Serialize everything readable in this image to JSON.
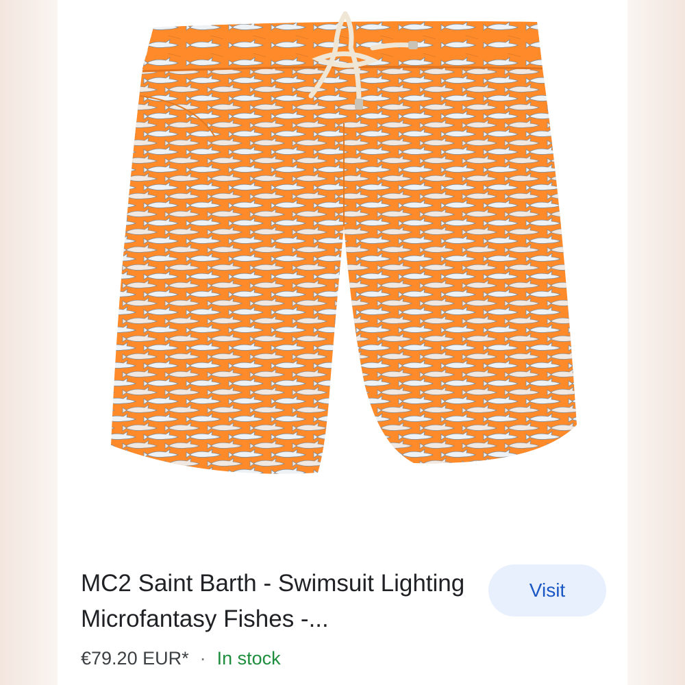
{
  "product": {
    "title": "MC2 Saint Barth - Swimsuit Lighting Microfantasy Fishes -...",
    "price": "€79.20 EUR*",
    "separator": "·",
    "stock": "In stock",
    "visit_label": "Visit"
  },
  "image": {
    "subject": "orange-swim-shorts-with-shark-print",
    "shorts_color": "#ff8a2a",
    "print_color": "#e9eef2",
    "drawstring_color": "#efe6d6"
  },
  "colors": {
    "accent": "#1a57c5",
    "button_bg": "#e8f0fe",
    "stock_green": "#1e8e3e",
    "title_text": "#202124"
  }
}
